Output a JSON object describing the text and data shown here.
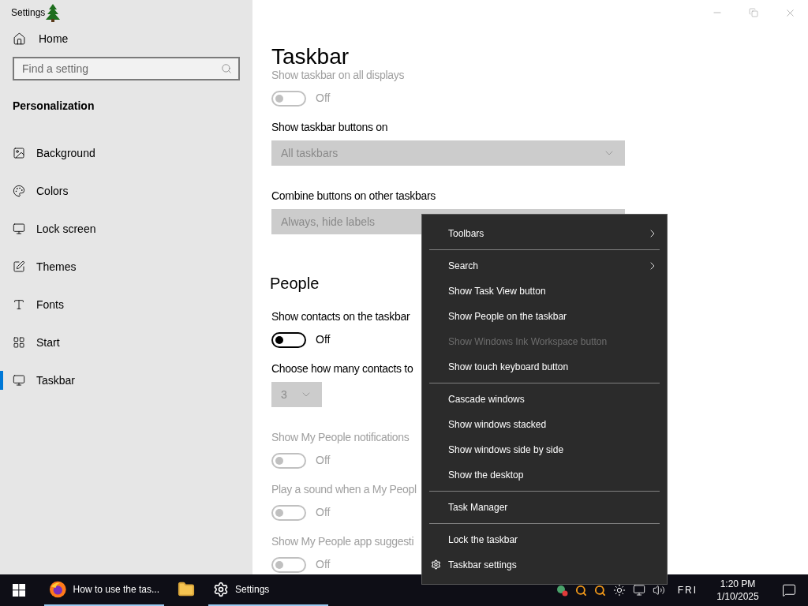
{
  "window": {
    "title": "Settings"
  },
  "sidebar": {
    "home": "Home",
    "search": {
      "placeholder": "Find a setting"
    },
    "section": "Personalization",
    "items": [
      {
        "label": "Background",
        "selected": false
      },
      {
        "label": "Colors",
        "selected": false
      },
      {
        "label": "Lock screen",
        "selected": false
      },
      {
        "label": "Themes",
        "selected": false
      },
      {
        "label": "Fonts",
        "selected": false
      },
      {
        "label": "Start",
        "selected": false
      },
      {
        "label": "Taskbar",
        "selected": true
      }
    ]
  },
  "page": {
    "title": "Taskbar",
    "settings": [
      {
        "kind": "toggle",
        "label": "Show taskbar on all displays",
        "on": false,
        "disabled": true,
        "state_text": "Off"
      },
      {
        "kind": "dropdown",
        "label": "Show taskbar buttons on",
        "value": "All taskbars",
        "disabled": true,
        "compact": false
      },
      {
        "kind": "dropdown",
        "label": "Combine buttons on other taskbars",
        "value": "Always, hide labels",
        "disabled": true,
        "compact": false,
        "covered": true
      },
      {
        "kind": "heading",
        "text": "People"
      },
      {
        "kind": "toggle",
        "label": "Show contacts on the taskbar",
        "on": false,
        "disabled": false,
        "state_text": "Off"
      },
      {
        "kind": "dropdown",
        "label": "Choose how many contacts to",
        "value": "3",
        "disabled": true,
        "compact": true
      },
      {
        "kind": "toggle",
        "label": "Show My People notifications",
        "on": false,
        "disabled": true,
        "state_text": "Off"
      },
      {
        "kind": "toggle",
        "label": "Play a sound when a My Peopl",
        "on": false,
        "disabled": true,
        "state_text": "Off"
      },
      {
        "kind": "toggle",
        "label": "Show My People app suggesti",
        "on": false,
        "disabled": true,
        "state_text": "Off"
      }
    ]
  },
  "context_menu": {
    "items": [
      {
        "kind": "item",
        "label": "Toolbars",
        "submenu": true,
        "disabled": false
      },
      {
        "kind": "separator"
      },
      {
        "kind": "item",
        "label": "Search",
        "submenu": true,
        "disabled": false
      },
      {
        "kind": "item",
        "label": "Show Task View button",
        "submenu": false,
        "disabled": false
      },
      {
        "kind": "item",
        "label": "Show People on the taskbar",
        "submenu": false,
        "disabled": false
      },
      {
        "kind": "item",
        "label": "Show Windows Ink Workspace button",
        "submenu": false,
        "disabled": true
      },
      {
        "kind": "item",
        "label": "Show touch keyboard button",
        "submenu": false,
        "disabled": false
      },
      {
        "kind": "separator"
      },
      {
        "kind": "item",
        "label": "Cascade windows",
        "submenu": false,
        "disabled": false
      },
      {
        "kind": "item",
        "label": "Show windows stacked",
        "submenu": false,
        "disabled": false
      },
      {
        "kind": "item",
        "label": "Show windows side by side",
        "submenu": false,
        "disabled": false
      },
      {
        "kind": "item",
        "label": "Show the desktop",
        "submenu": false,
        "disabled": false
      },
      {
        "kind": "separator"
      },
      {
        "kind": "item",
        "label": "Task Manager",
        "submenu": false,
        "disabled": false
      },
      {
        "kind": "separator"
      },
      {
        "kind": "item",
        "label": "Lock the taskbar",
        "submenu": false,
        "disabled": false
      },
      {
        "kind": "settings_item",
        "label": "Taskbar settings",
        "submenu": false,
        "disabled": false
      }
    ]
  },
  "taskbar": {
    "buttons": [
      {
        "kind": "browser",
        "label": "How to use the tas...",
        "running": true
      },
      {
        "kind": "folder",
        "running": false
      },
      {
        "kind": "settings",
        "label": "Settings",
        "running": true
      }
    ],
    "clock": {
      "day": "FRI",
      "time": "1:20 PM",
      "date": "1/10/2025"
    }
  }
}
